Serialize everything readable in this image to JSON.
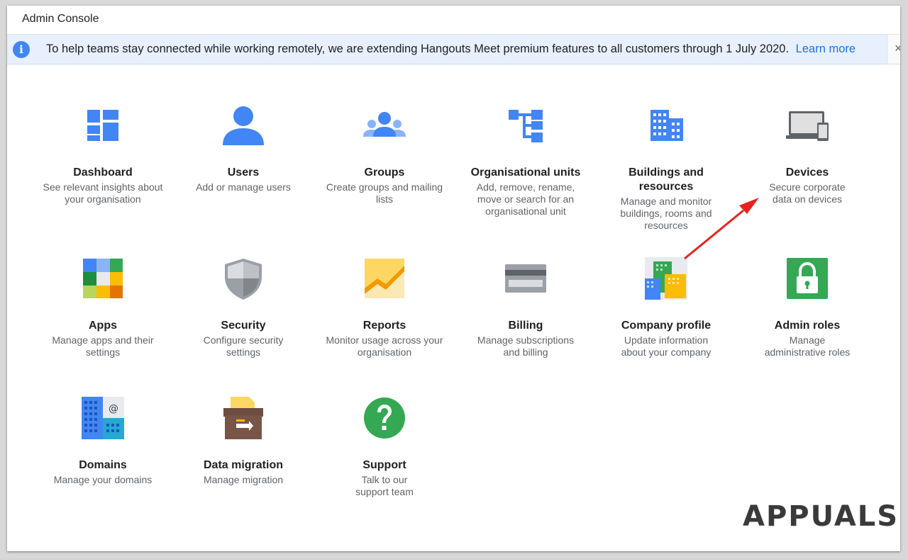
{
  "window": {
    "title": "Admin Console"
  },
  "banner": {
    "text": "To help teams stay connected while working remotely, we are extending Hangouts Meet premium features to all customers through 1 July 2020.",
    "link": "Learn more",
    "close_glyph": "×"
  },
  "tiles": [
    {
      "name": "Dashboard",
      "desc": "See relevant insights about your organisation",
      "icon": "dashboard-icon"
    },
    {
      "name": "Users",
      "desc": "Add or manage users",
      "icon": "user-icon"
    },
    {
      "name": "Groups",
      "desc": "Create groups and mailing lists",
      "icon": "groups-icon"
    },
    {
      "name": "Organisational units",
      "desc": "Add, remove, rename, move or search for an organisational unit",
      "icon": "org-units-icon"
    },
    {
      "name": "Buildings and resources",
      "desc": "Manage and monitor buildings, rooms and resources",
      "icon": "building-icon"
    },
    {
      "name": "Devices",
      "desc": "Secure corporate data on devices",
      "icon": "devices-icon"
    },
    {
      "name": "Apps",
      "desc": "Manage apps and their settings",
      "icon": "apps-icon"
    },
    {
      "name": "Security",
      "desc": "Configure security settings",
      "icon": "shield-icon"
    },
    {
      "name": "Reports",
      "desc": "Monitor usage across your organisation",
      "icon": "reports-icon"
    },
    {
      "name": "Billing",
      "desc": "Manage subscriptions and billing",
      "icon": "credit-card-icon"
    },
    {
      "name": "Company profile",
      "desc": "Update information about your company",
      "icon": "company-profile-icon"
    },
    {
      "name": "Admin roles",
      "desc": "Manage administrative roles",
      "icon": "lock-icon"
    },
    {
      "name": "Domains",
      "desc": "Manage your domains",
      "icon": "domains-icon"
    },
    {
      "name": "Data migration",
      "desc": "Manage migration",
      "icon": "data-migration-icon"
    },
    {
      "name": "Support",
      "desc": "Talk to our support team",
      "icon": "help-icon"
    }
  ],
  "annotation": {
    "color": "#e8231f",
    "shape": "arrow-icon"
  },
  "watermark": {
    "text": "APPUALS"
  },
  "colors": {
    "blue": "#4285f4",
    "link": "#1a73e8",
    "banner_bg": "#e8f0fe"
  }
}
